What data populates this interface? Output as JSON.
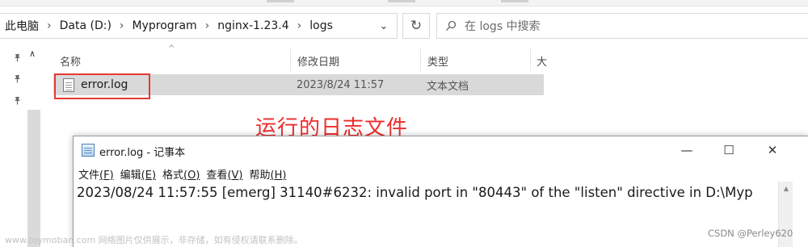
{
  "address_bar": {
    "breadcrumbs": [
      "此电脑",
      "Data (D:)",
      "Myprogram",
      "nginx-1.23.4",
      "logs"
    ],
    "separator": "›",
    "dropdown_glyph": "⌄",
    "refresh_glyph": "↻"
  },
  "search": {
    "placeholder": "在 logs 中搜索",
    "icon": "search-icon"
  },
  "columns": {
    "name": "名称",
    "date_modified": "修改日期",
    "type": "类型",
    "size": "大"
  },
  "files": [
    {
      "name": "error.log",
      "date_modified": "2023/8/24 11:57",
      "type": "文本文档",
      "selected": true
    }
  ],
  "annotation": {
    "text": "运行的日志文件",
    "color": "#ef2b2b"
  },
  "notepad": {
    "title": "error.log - 记事本",
    "controls": {
      "minimize": "—",
      "maximize": "☐",
      "close": "✕"
    },
    "menu": [
      {
        "label": "文件",
        "key": "(F)"
      },
      {
        "label": "编辑",
        "key": "(E)"
      },
      {
        "label": "格式",
        "key": "(O)"
      },
      {
        "label": "查看",
        "key": "(V)"
      },
      {
        "label": "帮助",
        "key": "(H)"
      }
    ],
    "content": "2023/08/24 11:57:55 [emerg] 31140#6232: invalid port in \"80443\" of the \"listen\" directive in D:\\Myp"
  },
  "watermarks": {
    "left": "www.toymoban.com 网络图片仅供展示，非存储，如有侵权请联系删除。",
    "right": "CSDN @Perley620"
  },
  "colors": {
    "highlight_border": "#e53935",
    "selected_row": "#d9d9d9"
  }
}
